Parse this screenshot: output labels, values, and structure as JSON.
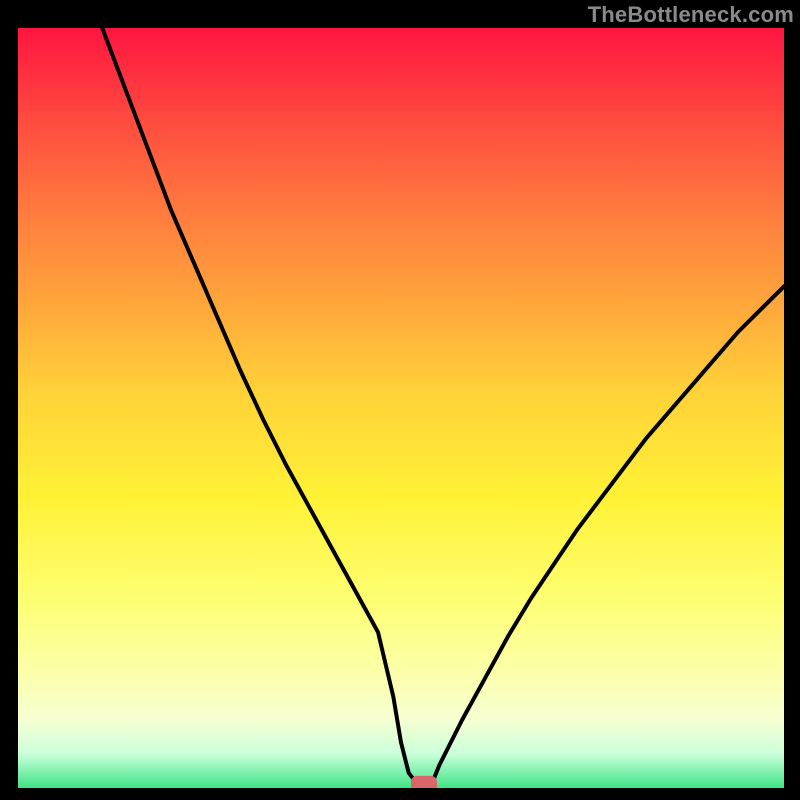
{
  "attribution": "TheBottleneck.com",
  "colors": {
    "gradient": [
      "#ff1540",
      "#ff4a3f",
      "#ff7a3e",
      "#ffa53b",
      "#ffd238",
      "#fff236",
      "#fdff76",
      "#fbffab",
      "#f7ffd2",
      "#caffda",
      "#3fe487"
    ],
    "curve": "#000000",
    "marker": "#d9666a",
    "frame": "#000000"
  },
  "chart_data": {
    "type": "line",
    "title": "",
    "xlabel": "",
    "ylabel": "",
    "xlim": [
      0,
      100
    ],
    "ylim": [
      0,
      100
    ],
    "x": [
      11,
      14,
      17,
      20,
      23,
      26,
      29,
      32,
      35,
      38,
      41,
      44,
      47,
      49,
      50,
      51,
      52,
      53,
      54,
      55,
      58,
      61,
      64,
      67,
      70,
      73,
      76,
      79,
      82,
      85,
      88,
      91,
      94,
      97,
      100
    ],
    "values": [
      100,
      92,
      84,
      76,
      69,
      62,
      55,
      48.5,
      42.5,
      37,
      31.5,
      26,
      20.5,
      12,
      6,
      2,
      0.7,
      0.5,
      0.5,
      3,
      9,
      14.5,
      20,
      25,
      29.5,
      34,
      38,
      42,
      46,
      49.5,
      53,
      56.5,
      60,
      63,
      66
    ],
    "marker": {
      "x": 53,
      "y": 0.5,
      "w": 3.4,
      "h": 2.2
    },
    "flat_segment": {
      "x1": 49.5,
      "x2": 54.2,
      "y": 0.5
    },
    "annotations": []
  }
}
